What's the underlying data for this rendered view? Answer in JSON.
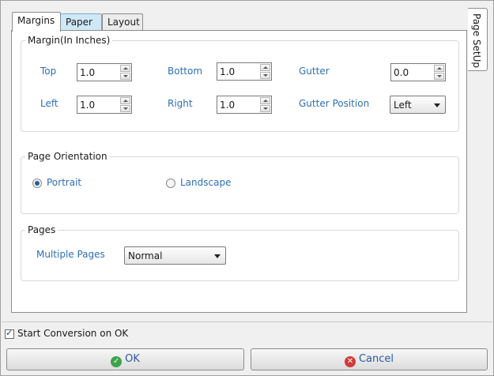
{
  "tabs": {
    "margins": "Margins",
    "paper": "Paper",
    "layout": "Layout"
  },
  "side_tab": "Page SetUp",
  "margin_group": {
    "title": "Margin(In Inches)",
    "top_label": "Top",
    "top_value": "1.0",
    "bottom_label": "Bottom",
    "bottom_value": "1.0",
    "gutter_label": "Gutter",
    "gutter_value": "0.0",
    "left_label": "Left",
    "left_value": "1.0",
    "right_label": "Right",
    "right_value": "1.0",
    "gutter_pos_label": "Gutter Position",
    "gutter_pos_value": "Left"
  },
  "orientation_group": {
    "title": "Page Orientation",
    "portrait": "Portrait",
    "landscape": "Landscape",
    "selected": "Portrait"
  },
  "pages_group": {
    "title": "Pages",
    "multiple_label": "Multiple Pages",
    "multiple_value": "Normal"
  },
  "footer": {
    "start_conversion": "Start Conversion on OK",
    "start_conversion_checked": true,
    "ok": "OK",
    "cancel": "Cancel"
  },
  "colors": {
    "label_blue": "#2f6fb7",
    "ok_green": "#3ba34a",
    "cancel_red": "#d23b3b"
  }
}
